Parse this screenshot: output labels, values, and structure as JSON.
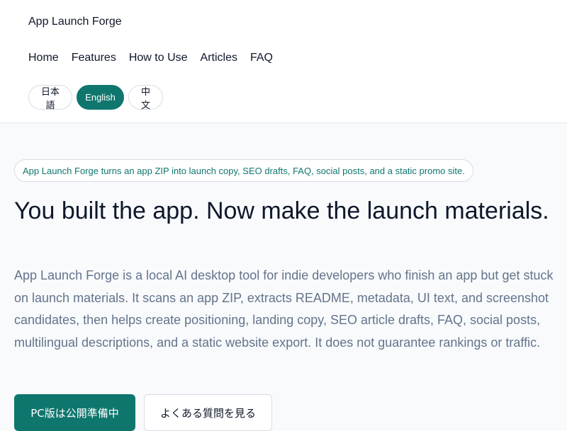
{
  "header": {
    "site_title": "App Launch Forge",
    "nav": [
      {
        "label": "Home"
      },
      {
        "label": "Features"
      },
      {
        "label": "How to Use"
      },
      {
        "label": "Articles"
      },
      {
        "label": "FAQ"
      }
    ],
    "languages": [
      {
        "label": "日本語",
        "active": false
      },
      {
        "label": "English",
        "active": true
      },
      {
        "label": "中文",
        "active": false
      }
    ]
  },
  "hero": {
    "tagline": "App Launch Forge turns an app ZIP into launch copy, SEO drafts, FAQ, social posts, and a static promo site.",
    "headline": "You built the app. Now make the launch materials.",
    "description": "App Launch Forge is a local AI desktop tool for indie developers who finish an app but get stuck on launch materials. It scans an app ZIP, extracts README, metadata, UI text, and screenshot candidates, then helps create positioning, landing copy, SEO article drafts, FAQ, social posts, multilingual descriptions, and a static website export. It does not guarantee rankings or traffic.",
    "primary_cta": "PC版は公開準備中",
    "secondary_cta": "よくある質問を見る"
  },
  "colors": {
    "accent": "#0f766e",
    "text": "#0f172a",
    "muted": "#64748b",
    "background": "#f8fafc",
    "border": "#d7dde5"
  }
}
